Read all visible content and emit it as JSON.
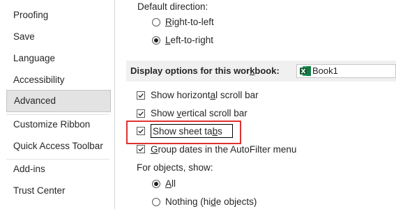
{
  "sidebar": {
    "items": [
      {
        "label": "Proofing",
        "selected": false
      },
      {
        "label": "Save",
        "selected": false
      },
      {
        "label": "Language",
        "selected": false
      },
      {
        "label": "Accessibility",
        "selected": false
      },
      {
        "label": "Advanced",
        "selected": true
      },
      {
        "label": "Customize Ribbon",
        "selected": false
      },
      {
        "label": "Quick Access Toolbar",
        "selected": false
      },
      {
        "label": "Add-ins",
        "selected": false
      },
      {
        "label": "Trust Center",
        "selected": false
      }
    ]
  },
  "direction": {
    "label": "Default direction:",
    "options": [
      {
        "pre": "",
        "ul": "R",
        "post": "ight-to-left",
        "checked": false
      },
      {
        "pre": "",
        "ul": "L",
        "post": "eft-to-right",
        "checked": true
      }
    ]
  },
  "workbook_section": {
    "title_pre": "Display options for this wor",
    "title_ul": "k",
    "title_post": "book:",
    "selected_workbook": "Book1",
    "icon": "excel-icon"
  },
  "options": [
    {
      "pre": "Show horizont",
      "ul": "a",
      "post": "l scroll bar",
      "checked": true
    },
    {
      "pre": "Show ",
      "ul": "v",
      "post": "ertical scroll bar",
      "checked": true
    },
    {
      "pre": "Show sheet ta",
      "ul": "b",
      "post": "s",
      "checked": true
    },
    {
      "pre": "",
      "ul": "G",
      "post": "roup dates in the AutoFilter menu",
      "checked": true
    }
  ],
  "objects": {
    "label": "For objects, show:",
    "options": [
      {
        "pre": "",
        "ul": "A",
        "post": "ll",
        "checked": true
      },
      {
        "pre": "Nothing (hi",
        "ul": "d",
        "post": "e objects)",
        "checked": false
      }
    ]
  },
  "colors": {
    "highlight": "#e0312f",
    "selected_bg": "#e3e3e3",
    "section_bg": "#f0f0f0"
  }
}
